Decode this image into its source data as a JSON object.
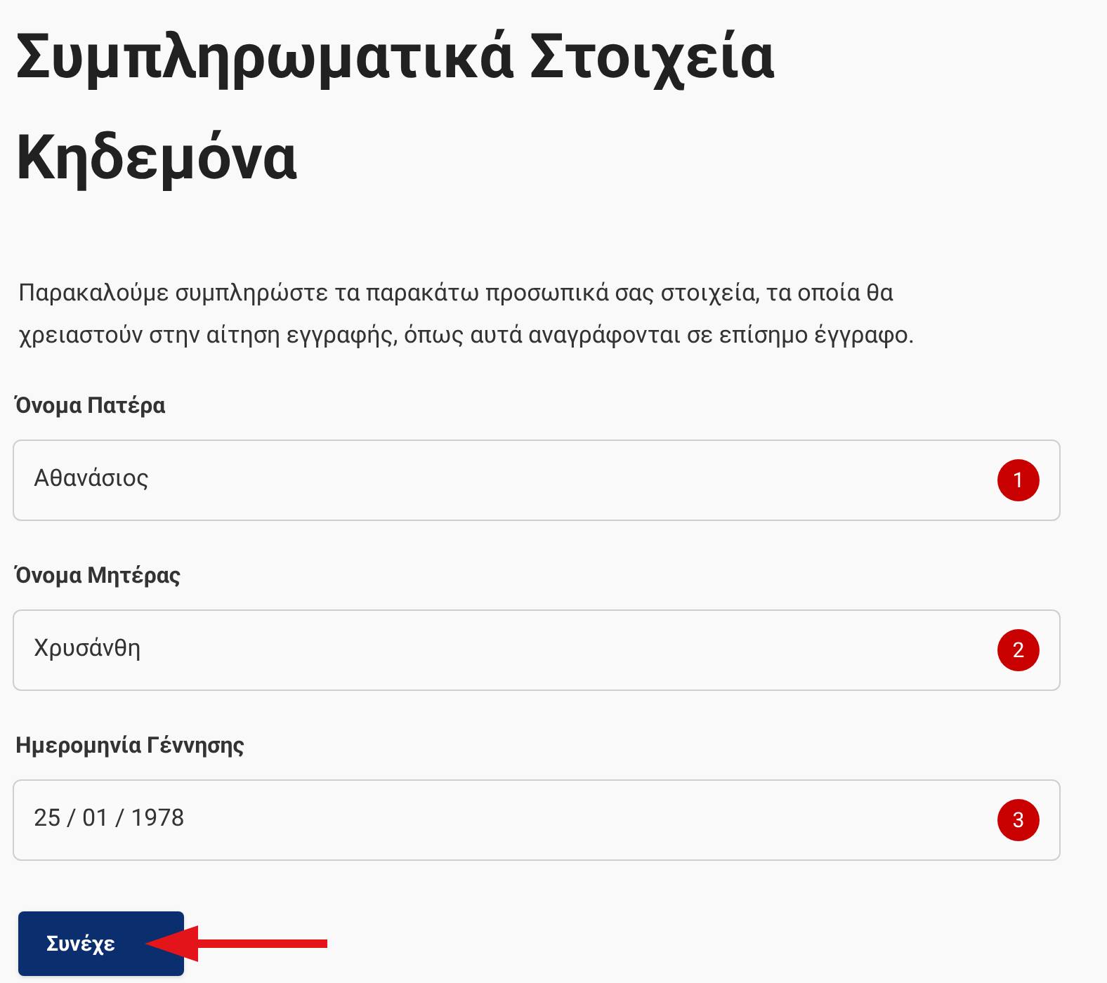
{
  "title": "Συμπληρωματικά Στοιχεία Κηδεμόνα",
  "intro": "Παρακαλούμε συμπληρώστε τα παρακάτω προσωπικά σας στοιχεία, τα οποία θα χρειαστούν στην αίτηση εγγραφής, όπως αυτά αναγράφονται σε επίσημο έγγραφο.",
  "fields": [
    {
      "label": "Όνομα Πατέρα",
      "value": "Αθανάσιος",
      "marker": "1"
    },
    {
      "label": "Όνομα Μητέρας",
      "value": "Χρυσάνθη",
      "marker": "2"
    },
    {
      "label": "Ημερομηνία Γέννησης",
      "value": "25 / 01 / 1978",
      "marker": "3"
    }
  ],
  "continue_button": "Συνέχε"
}
